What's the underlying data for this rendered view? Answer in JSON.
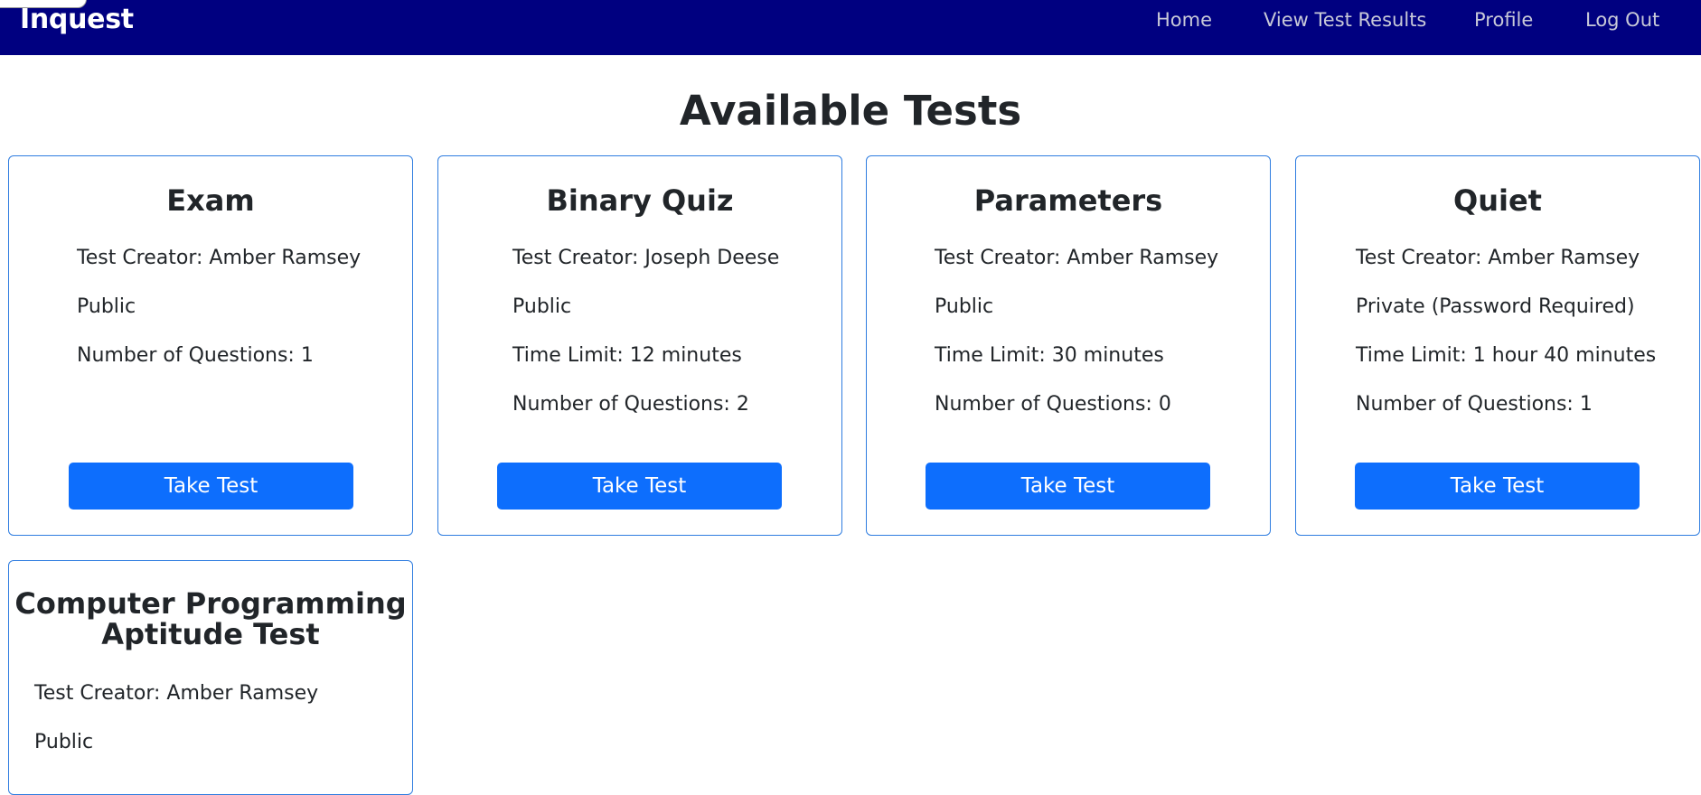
{
  "navbar": {
    "brand": "Inquest",
    "links": [
      "Home",
      "View Test Results",
      "Profile",
      "Log Out"
    ],
    "background": "#000080"
  },
  "page": {
    "title": "Available Tests"
  },
  "cards": [
    {
      "title": "Exam",
      "lines": [
        "Test Creator: Amber Ramsey",
        "Public",
        "Number of Questions: 1"
      ],
      "button": "Take Test"
    },
    {
      "title": "Binary Quiz",
      "lines": [
        "Test Creator: Joseph Deese",
        "Public",
        "Time Limit: 12 minutes",
        "Number of Questions: 2"
      ],
      "button": "Take Test"
    },
    {
      "title": "Parameters",
      "lines": [
        "Test Creator: Amber Ramsey",
        "Public",
        "Time Limit: 30 minutes",
        "Number of Questions: 0"
      ],
      "button": "Take Test"
    },
    {
      "title": "Quiet",
      "lines": [
        "Test Creator: Amber Ramsey",
        "Private (Password Required)",
        "Time Limit: 1 hour 40 minutes",
        "Number of Questions: 1"
      ],
      "button": "Take Test"
    },
    {
      "title_line1": "Computer Programming",
      "title_line2": "Aptitude Test",
      "lines": [
        "Test Creator: Amber Ramsey",
        "Public"
      ]
    }
  ],
  "colors": {
    "accent": "#0d6efd",
    "card_border": "#2f7de0"
  }
}
